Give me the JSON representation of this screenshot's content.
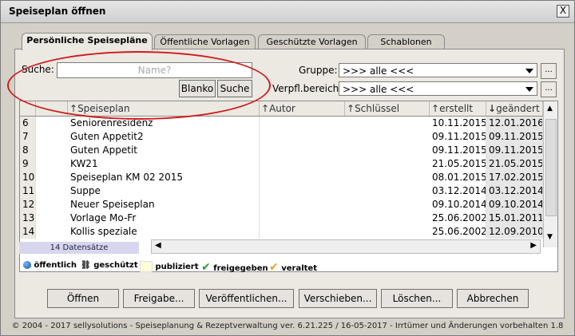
{
  "window": {
    "title": "Speiseplan öffnen",
    "close_label": "X"
  },
  "tabs": [
    {
      "label": "Persönliche Speisepläne",
      "active": true
    },
    {
      "label": "Öffentliche Vorlagen",
      "active": false
    },
    {
      "label": "Geschützte Vorlagen",
      "active": false
    },
    {
      "label": "Schablonen",
      "active": false
    }
  ],
  "search": {
    "label": "Suche:",
    "placeholder": "Name?",
    "value": ""
  },
  "buttons": {
    "blanko": "Blanko",
    "suche": "Suche"
  },
  "gruppe": {
    "label": "Gruppe:",
    "value": ">>> alle <<<",
    "dots": "..."
  },
  "verpfl": {
    "label": "Verpfl.bereich:",
    "value": ">>> alle <<<",
    "dots": "..."
  },
  "columns": [
    "Speiseplan",
    "Autor",
    "Schlüssel",
    "erstellt",
    "geändert"
  ],
  "rows": [
    {
      "nr": "6",
      "name": "Seniorenresidenz",
      "autor": "",
      "schluessel": "",
      "erstellt": "10.11.2015",
      "geaendert": "12.01.2016"
    },
    {
      "nr": "7",
      "name": "Guten Appetit2",
      "autor": "",
      "schluessel": "",
      "erstellt": "09.11.2015",
      "geaendert": "09.11.2015"
    },
    {
      "nr": "8",
      "name": "Guten Appetit",
      "autor": "",
      "schluessel": "",
      "erstellt": "09.11.2015",
      "geaendert": "09.11.2015"
    },
    {
      "nr": "9",
      "name": "KW21",
      "autor": "",
      "schluessel": "",
      "erstellt": "21.05.2015",
      "geaendert": "21.05.2015"
    },
    {
      "nr": "10",
      "name": "Speiseplan KM 02 2015",
      "autor": "",
      "schluessel": "",
      "erstellt": "08.01.2015",
      "geaendert": "17.02.2015"
    },
    {
      "nr": "11",
      "name": "Suppe",
      "autor": "",
      "schluessel": "",
      "erstellt": "03.12.2014",
      "geaendert": "03.12.2014"
    },
    {
      "nr": "12",
      "name": "Neuer Speiseplan",
      "autor": "",
      "schluessel": "",
      "erstellt": "09.10.2014",
      "geaendert": "09.10.2014"
    },
    {
      "nr": "13",
      "name": "Vorlage Mo-Fr",
      "autor": "",
      "schluessel": "",
      "erstellt": "25.06.2002",
      "geaendert": "15.01.2011"
    },
    {
      "nr": "14",
      "name": "Kollis speziale",
      "autor": "",
      "schluessel": "",
      "erstellt": "25.06.2002",
      "geaendert": "12.09.2010"
    }
  ],
  "record_count": "14 Datensätze",
  "legend": [
    {
      "label": "öffentlich",
      "icon": "globe-icon"
    },
    {
      "label": "geschützt",
      "icon": "chain-icon"
    },
    {
      "label": "publiziert",
      "icon": "square-icon"
    },
    {
      "label": "freigegeben",
      "icon": "check-green-icon"
    },
    {
      "label": "veraltet",
      "icon": "check-orange-icon"
    }
  ],
  "actions": [
    "Öffnen",
    "Freigabe...",
    "Veröffentlichen...",
    "Verschieben...",
    "Löschen...",
    "Abbrechen"
  ],
  "footer": "© 2004 - 2017 sellysolutions - Speiseplanung & Rezeptverwaltung ver. 6.21.225 / 16-05-2017 - Irrtümer und Änderungen vorbehalten  1.8",
  "colors": {
    "annotation": "#d01c1c",
    "check_green": "#2e9e2e",
    "check_orange": "#f0a020"
  }
}
